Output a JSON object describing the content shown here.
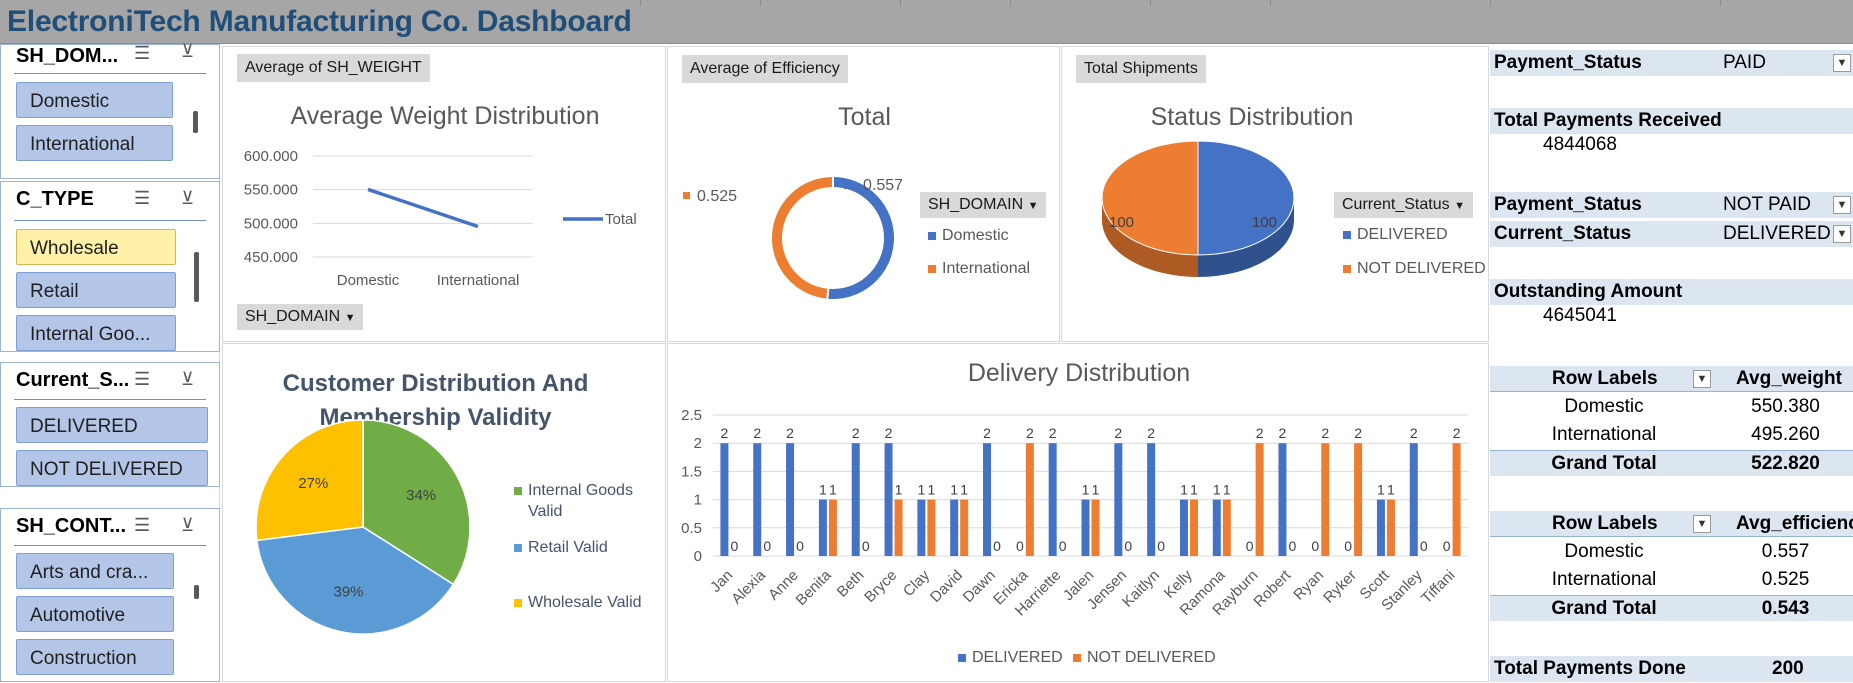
{
  "header": {
    "title": "ElectroniTech Manufacturing Co. Dashboard"
  },
  "slicers": [
    {
      "title": "SH_DOM...",
      "items": [
        {
          "label": "Domestic",
          "selected": false
        },
        {
          "label": "International",
          "selected": false
        }
      ]
    },
    {
      "title": "C_TYPE",
      "items": [
        {
          "label": "Wholesale",
          "selected": true
        },
        {
          "label": "Retail",
          "selected": false
        },
        {
          "label": "Internal Goo...",
          "selected": false
        }
      ]
    },
    {
      "title": "Current_S...",
      "items": [
        {
          "label": "DELIVERED",
          "selected": false
        },
        {
          "label": "NOT DELIVERED",
          "selected": false
        }
      ]
    },
    {
      "title": "SH_CONT...",
      "items": [
        {
          "label": "Arts and cra...",
          "selected": false
        },
        {
          "label": "Automotive",
          "selected": false
        },
        {
          "label": "Construction",
          "selected": false
        }
      ]
    }
  ],
  "icons": {
    "multiselect": "multi-select-icon",
    "clearfilter": "clear-filter-icon",
    "dropdown": "dropdown-arrow-icon"
  },
  "colors": {
    "blue": "#4472c4",
    "orange": "#ed7d31",
    "green": "#70ad47",
    "lightblue": "#5b9bd5",
    "gold": "#ffc000",
    "title": "#1f4e79"
  },
  "charts": {
    "weight": {
      "field_button": "Average of SH_WEIGHT",
      "title": "Average Weight Distribution",
      "legend": "Total",
      "filter_button": "SH_DOMAIN"
    },
    "efficiency": {
      "field_button": "Average of Efficiency",
      "title": "Total",
      "filter_button": "SH_DOMAIN",
      "legend": [
        "Domestic",
        "International"
      ],
      "labels": [
        "0.557",
        "0.525"
      ]
    },
    "status": {
      "field_button": "Total Shipments",
      "title": "Status Distribution",
      "filter_button": "Current_Status",
      "legend": [
        "DELIVERED",
        "NOT DELIVERED"
      ],
      "labels": [
        "100",
        "100"
      ]
    },
    "customer": {
      "title_line1": "Customer Distribution And",
      "title_line2": "Membership Validity",
      "legend": [
        "Internal Goods",
        "Valid",
        "Retail Valid",
        "Wholesale Valid"
      ],
      "labels": [
        "34%",
        "39%",
        "27%"
      ]
    },
    "delivery": {
      "title": "Delivery Distribution",
      "legend": [
        "DELIVERED",
        "NOT DELIVERED"
      ]
    }
  },
  "chart_data": [
    {
      "type": "line",
      "title": "Average Weight Distribution",
      "categories": [
        "Domestic",
        "International"
      ],
      "series": [
        {
          "name": "Total",
          "values": [
            550.38,
            495.26
          ]
        }
      ],
      "yticks": [
        "450.000",
        "500.000",
        "550.000",
        "600.000"
      ],
      "ylim": [
        450,
        600
      ]
    },
    {
      "type": "pie",
      "title": "Total",
      "categories": [
        "Domestic",
        "International"
      ],
      "values": [
        0.557,
        0.525
      ]
    },
    {
      "type": "pie",
      "title": "Status Distribution",
      "categories": [
        "DELIVERED",
        "NOT DELIVERED"
      ],
      "values": [
        100,
        100
      ]
    },
    {
      "type": "pie",
      "title": "Customer Distribution And Membership Validity",
      "categories": [
        "Internal Goods Valid",
        "Retail Valid",
        "Wholesale Valid"
      ],
      "values": [
        34,
        39,
        27
      ]
    },
    {
      "type": "bar",
      "title": "Delivery Distribution",
      "categories": [
        "Jan",
        "Alexia",
        "Anne",
        "Benita",
        "Beth",
        "Bryce",
        "Clay",
        "David",
        "Dawn",
        "Ericka",
        "Harriette",
        "Jalen",
        "Jensen",
        "Kaitlyn",
        "Kelly",
        "Ramona",
        "Rayburn",
        "Robert",
        "Ryan",
        "Ryker",
        "Scott",
        "Stanley",
        "Tiffani"
      ],
      "series": [
        {
          "name": "DELIVERED",
          "values": [
            2,
            2,
            2,
            1,
            2,
            2,
            1,
            1,
            2,
            0,
            2,
            1,
            2,
            2,
            1,
            1,
            0,
            2,
            0,
            0,
            1,
            2,
            0
          ]
        },
        {
          "name": "NOT DELIVERED",
          "values": [
            0,
            0,
            0,
            1,
            0,
            1,
            1,
            1,
            0,
            2,
            0,
            1,
            0,
            0,
            1,
            1,
            2,
            0,
            2,
            2,
            1,
            0,
            2
          ]
        }
      ],
      "yticks": [
        "0",
        "0.5",
        "1",
        "1.5",
        "2",
        "2.5"
      ],
      "ylim": [
        0,
        2.5
      ]
    }
  ],
  "pivot": {
    "paid": {
      "key": "Payment_Status",
      "value": "PAID"
    },
    "received": {
      "key": "Total Payments Received",
      "value": "4844068"
    },
    "notpaid": {
      "key": "Payment_Status",
      "value": "NOT PAID"
    },
    "delivered": {
      "key": "Current_Status",
      "value": "DELIVERED"
    },
    "outstanding": {
      "key": "Outstanding Amount",
      "value": "4645041"
    },
    "weight_table": {
      "col1": "Row Labels",
      "col2": "Avg_weight",
      "rows": [
        [
          "Domestic",
          "550.380"
        ],
        [
          "International",
          "495.260"
        ]
      ],
      "total": [
        "Grand Total",
        "522.820"
      ]
    },
    "eff_table": {
      "col1": "Row Labels",
      "col2": "Avg_efficiency",
      "rows": [
        [
          "Domestic",
          "0.557"
        ],
        [
          "International",
          "0.525"
        ]
      ],
      "total": [
        "Grand Total",
        "0.543"
      ]
    },
    "done": {
      "key": "Total Payments Done",
      "value": "200"
    }
  }
}
